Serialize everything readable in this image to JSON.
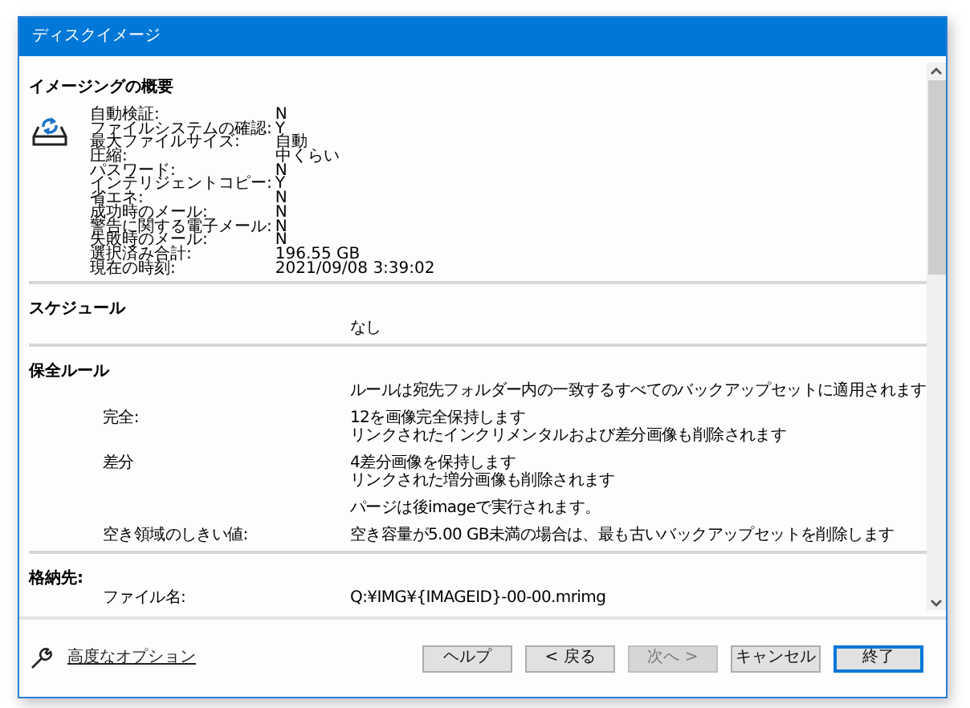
{
  "window": {
    "title": "ディスクイメージ"
  },
  "summary": {
    "heading": "イメージングの概要",
    "rows": [
      {
        "label": "自動検証:",
        "value": "N"
      },
      {
        "label": "ファイルシステムの確認:",
        "value": "Y"
      },
      {
        "label": "最大ファイルサイズ:",
        "value": "自動"
      },
      {
        "label": "圧縮:",
        "value": "中くらい"
      },
      {
        "label": "パスワード:",
        "value": "N"
      },
      {
        "label": "インテリジェントコピー:",
        "value": "Y"
      },
      {
        "label": "省エネ:",
        "value": "N"
      },
      {
        "label": "成功時のメール:",
        "value": "N"
      },
      {
        "label": "警告に関する電子メール:",
        "value": "N"
      },
      {
        "label": "失敗時のメール:",
        "value": "N"
      },
      {
        "label": "選択済み合計:",
        "value": "196.55 GB"
      },
      {
        "label": "現在の時刻:",
        "value": "2021/09/08 3:39:02"
      }
    ]
  },
  "schedule": {
    "heading": "スケジュール",
    "value": "なし"
  },
  "retention": {
    "heading": "保全ルール",
    "note": "ルールは宛先フォルダー内の一致するすべてのバックアップセットに適用されます",
    "rules": [
      {
        "label": "完全:",
        "lines": [
          "12を画像完全保持します",
          "リンクされたインクリメンタルおよび差分画像も削除されます"
        ]
      },
      {
        "label": "差分",
        "lines": [
          "4差分画像を保持します",
          "リンクされた増分画像も削除されます"
        ]
      },
      {
        "lines": [
          "パージは後imageで実行されます。"
        ]
      },
      {
        "label": "空き領域のしきい値:",
        "lines": [
          "空き容量が5.00 GB未満の場合は、最も古いバックアップセットを削除します"
        ]
      }
    ]
  },
  "storage": {
    "heading": "格納先:",
    "rows": [
      {
        "label": "ファイル名:",
        "value": "Q:¥IMG¥{IMAGEID}-00-00.mrimg"
      }
    ]
  },
  "footer": {
    "link": "高度なオプション",
    "buttons": [
      {
        "label": "ヘルプ",
        "disabled": false,
        "default": false
      },
      {
        "label": "< 戻る",
        "disabled": false,
        "default": false
      },
      {
        "label": "次へ >",
        "disabled": true,
        "default": false
      },
      {
        "label": "キャンセル",
        "disabled": false,
        "default": false
      },
      {
        "label": "終了",
        "disabled": false,
        "default": true
      }
    ]
  }
}
